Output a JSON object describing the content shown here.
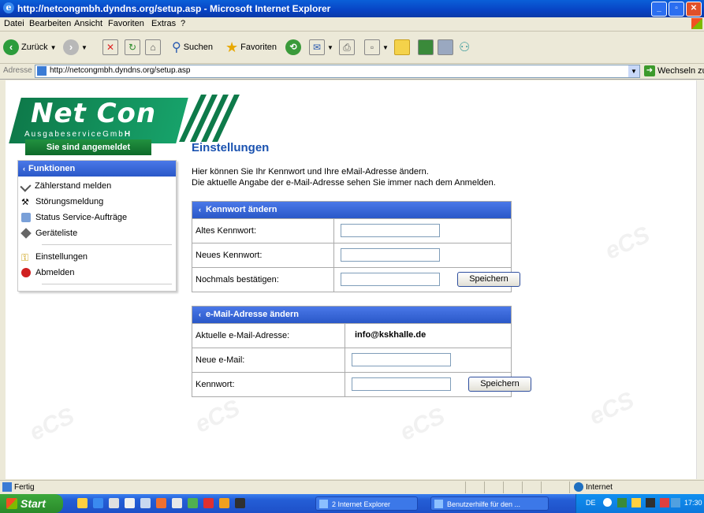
{
  "window": {
    "title": "http://netcongmbh.dyndns.org/setup.asp - Microsoft Internet Explorer"
  },
  "menu": [
    "Datei",
    "Bearbeiten",
    "Ansicht",
    "Favoriten",
    "Extras",
    "?"
  ],
  "toolbar": {
    "back_label": "Zurück",
    "search_label": "Suchen",
    "favorites_label": "Favoriten"
  },
  "address": {
    "label": "Adresse",
    "url": "http://netcongmbh.dyndns.org/setup.asp",
    "go_label": "Wechseln zu"
  },
  "logo": {
    "name": "Net Con",
    "sub_pre": "AusgabeserviceGmb",
    "sub_bold": "H"
  },
  "login_status": "Sie sind angemeldet",
  "sidebar": {
    "header": "Funktionen",
    "items": [
      {
        "label": "Zählerstand melden"
      },
      {
        "label": "Störungsmeldung"
      },
      {
        "label": "Status Service-Aufträge"
      },
      {
        "label": "Geräteliste"
      },
      {
        "label": "Einstellungen"
      },
      {
        "label": "Abmelden"
      }
    ]
  },
  "main": {
    "title": "Einstellungen",
    "intro_line1": "Hier können Sie Ihr Kennwort und Ihre eMail-Adresse ändern.",
    "intro_line2": "Die aktuelle Angabe der e-Mail-Adresse sehen Sie immer nach dem Anmelden."
  },
  "password_panel": {
    "header": "Kennwort ändern",
    "old_label": "Altes Kennwort:",
    "new_label": "Neues Kennwort:",
    "confirm_label": "Nochmals bestätigen:",
    "save_label": "Speichern"
  },
  "email_panel": {
    "header": "e-Mail-Adresse ändern",
    "current_label": "Aktuelle e-Mail-Adresse:",
    "current_value": "info@kskhalle.de",
    "new_label": "Neue e-Mail:",
    "password_label": "Kennwort:",
    "save_label": "Speichern"
  },
  "status": {
    "text": "Fertig",
    "zone": "Internet"
  },
  "taskbar": {
    "start_label": "Start",
    "tasks": [
      "2 Internet Explorer",
      "Benutzerhilfe für den ..."
    ],
    "lang": "DE",
    "clock": "17:30"
  },
  "colors": {
    "accent_blue": "#2a58c8",
    "brand_green": "#0e7a4a"
  }
}
